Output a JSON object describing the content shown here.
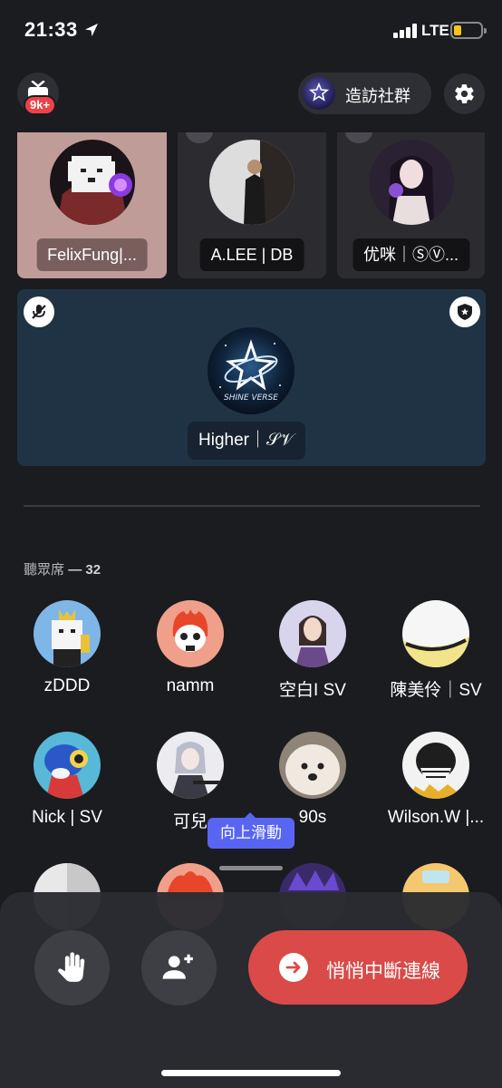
{
  "status_bar": {
    "time": "21:33",
    "network": "LTE",
    "battery_level": 0.2
  },
  "header": {
    "notification_badge": "9k+",
    "visit_community_label": "造訪社群",
    "visit_logo_text": "SHINE VERSE"
  },
  "stage": {
    "speakers": [
      {
        "name": "FelixFung|..."
      },
      {
        "name": "A.LEE | DB"
      },
      {
        "name": "优咪｜ⓈⓋ..."
      }
    ],
    "featured": {
      "name": "Higher｜𝒮𝒱",
      "logo_text": "SHINE VERSE"
    }
  },
  "audience": {
    "label": "聽眾席",
    "separator": "—",
    "count": "32",
    "members": [
      {
        "name": "zDDD"
      },
      {
        "name": "namm"
      },
      {
        "name": "空白I SV"
      },
      {
        "name": "陳美伶｜SV"
      },
      {
        "name": "Nick | SV"
      },
      {
        "name": "可兒"
      },
      {
        "name": "90s"
      },
      {
        "name": "Wilson.W |..."
      }
    ]
  },
  "swipe_tip": "向上滑動",
  "actions": {
    "leave_label": "悄悄中斷連線"
  },
  "colors": {
    "background": "#1b1c20",
    "leave": "#da4a48",
    "tooltip": "#5865f2",
    "badge": "#ed4245"
  },
  "icons": [
    "location-arrow-icon",
    "tv-icon",
    "gear-icon",
    "mic-off-icon",
    "shield-star-icon",
    "raise-hand-icon",
    "add-user-icon",
    "arrow-right-icon"
  ]
}
